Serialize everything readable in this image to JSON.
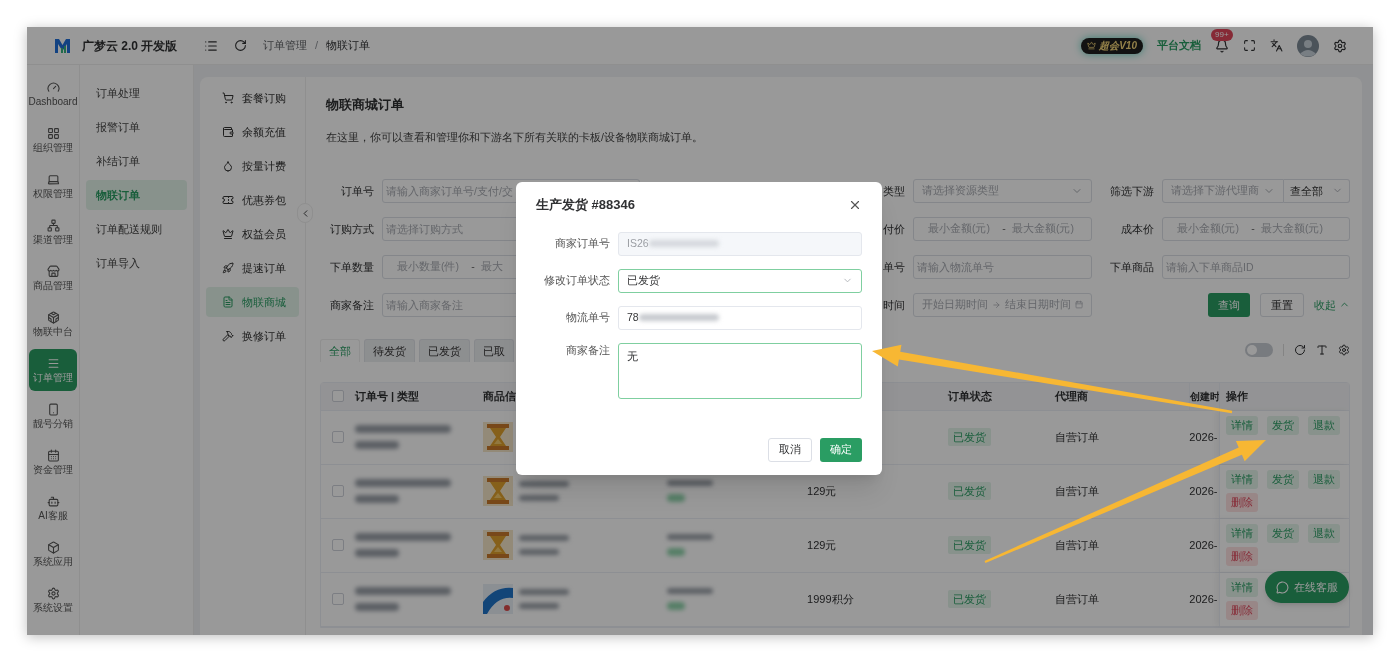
{
  "header": {
    "app_name": "广梦云 2.0 开发版",
    "breadcrumb": [
      "订单管理",
      "物联订单"
    ],
    "breadcrumb_separator": "/",
    "vip_badge": "超会V10",
    "docs_link": "平台文档",
    "notification_count": "99+"
  },
  "rail": [
    {
      "label": "Dashboard",
      "selected": false
    },
    {
      "label": "组织管理",
      "selected": false
    },
    {
      "label": "权限管理",
      "selected": false
    },
    {
      "label": "渠道管理",
      "selected": false
    },
    {
      "label": "商品管理",
      "selected": false
    },
    {
      "label": "物联中台",
      "selected": false
    },
    {
      "label": "订单管理",
      "selected": true
    },
    {
      "label": "靓号分销",
      "selected": false
    },
    {
      "label": "资金管理",
      "selected": false
    },
    {
      "label": "AI客服",
      "selected": false
    },
    {
      "label": "系统应用",
      "selected": false
    },
    {
      "label": "系统设置",
      "selected": false
    }
  ],
  "submenu": [
    {
      "label": "订单处理",
      "selected": false
    },
    {
      "label": "报警订单",
      "selected": false
    },
    {
      "label": "补结订单",
      "selected": false
    },
    {
      "label": "物联订单",
      "selected": true
    },
    {
      "label": "订单配送规则",
      "selected": false
    },
    {
      "label": "订单导入",
      "selected": false
    }
  ],
  "inner_menu": [
    {
      "label": "套餐订购",
      "selected": false
    },
    {
      "label": "余额充值",
      "selected": false
    },
    {
      "label": "按量计费",
      "selected": false
    },
    {
      "label": "优惠券包",
      "selected": false
    },
    {
      "label": "权益会员",
      "selected": false
    },
    {
      "label": "提速订单",
      "selected": false
    },
    {
      "label": "物联商城",
      "selected": true
    },
    {
      "label": "换修订单",
      "selected": false
    }
  ],
  "page": {
    "title": "物联商城订单",
    "description": "在这里，你可以查看和管理你和下游名下所有关联的卡板/设备物联商城订单。"
  },
  "filters": [
    [
      {
        "label": "订单号",
        "kind": "input",
        "placeholder": "请输入商家订单号/支付/交"
      },
      {
        "label": "类型",
        "kind": "select",
        "placeholder": "请选择资源类型"
      },
      {
        "label": "筛选下游",
        "kind": "select_pair",
        "placeholder": "请选择下游代理商",
        "value": "查全部"
      }
    ],
    [
      {
        "label": "订购方式",
        "kind": "input",
        "placeholder": "请选择订购方式"
      },
      {
        "label": "付价",
        "kind": "range",
        "placeholder": "最小金额(元)",
        "placeholder_end": "最大金额(元)",
        "separator": "-"
      },
      {
        "label": "成本价",
        "kind": "range",
        "placeholder": "最小金额(元)",
        "placeholder_end": "最大金额(元)",
        "separator": "-"
      }
    ],
    [
      {
        "label": "下单数量",
        "kind": "range",
        "placeholder": "最小数量(件)",
        "placeholder_end": "最大",
        "separator": "-"
      },
      {
        "label": "单号",
        "kind": "input",
        "placeholder": "请输入物流单号"
      },
      {
        "label": "下单商品",
        "kind": "input",
        "placeholder": "请输入下单商品ID"
      }
    ],
    [
      {
        "label": "商家备注",
        "kind": "input",
        "placeholder": "请输入商家备注"
      },
      {
        "label": "时间",
        "kind": "daterange",
        "placeholder": "开始日期时间",
        "placeholder_end": "结束日期时间"
      }
    ]
  ],
  "filter_actions": [
    {
      "label": "查询",
      "kind": "primary"
    },
    {
      "label": "重置",
      "kind": "default"
    },
    {
      "label": "收起",
      "kind": "link"
    }
  ],
  "tabs": [
    {
      "label": "全部",
      "selected": true
    },
    {
      "label": "待发货",
      "selected": false
    },
    {
      "label": "已发货",
      "selected": false
    },
    {
      "label": "已取",
      "selected": false
    }
  ],
  "table_switch": {
    "on": false
  },
  "table": {
    "all_checked": false,
    "columns": [
      "订单号 | 类型",
      "商品信",
      "订单状态",
      "代理商",
      "创建时",
      "操作"
    ],
    "rows": [
      {
        "checked": false,
        "status": "已发货",
        "agent": "自营订单",
        "created": "2026-",
        "actions": [
          {
            "label": "详情",
            "kind": "default"
          },
          {
            "label": "发货",
            "kind": "default"
          },
          {
            "label": "退款",
            "kind": "default"
          }
        ]
      },
      {
        "checked": false,
        "price": "129元",
        "status": "已发货",
        "agent": "自营订单",
        "created": "2026-",
        "actions": [
          {
            "label": "详情",
            "kind": "default"
          },
          {
            "label": "发货",
            "kind": "default"
          },
          {
            "label": "退款",
            "kind": "default"
          },
          {
            "label": "删除",
            "kind": "danger"
          }
        ]
      },
      {
        "checked": false,
        "price": "129元",
        "status": "已发货",
        "agent": "自营订单",
        "created": "2026-",
        "actions": [
          {
            "label": "详情",
            "kind": "default"
          },
          {
            "label": "发货",
            "kind": "default"
          },
          {
            "label": "退款",
            "kind": "default"
          },
          {
            "label": "删除",
            "kind": "danger"
          }
        ]
      },
      {
        "checked": false,
        "price": "1999积分",
        "status": "已发货",
        "agent": "自营订单",
        "created": "2026-",
        "actions": [
          {
            "label": "详情",
            "kind": "default"
          },
          {
            "label": "删除",
            "kind": "danger"
          }
        ]
      }
    ]
  },
  "chat_button": "在线客服",
  "modal": {
    "title": "生产发货 #88346",
    "fields": [
      {
        "label": "商家订单号",
        "kind": "disabled",
        "value": "IS26"
      },
      {
        "label": "修改订单状态",
        "kind": "select",
        "value": "已发货"
      },
      {
        "label": "物流单号",
        "kind": "input",
        "value": "78"
      },
      {
        "label": "商家备注",
        "kind": "textarea",
        "value": "无"
      }
    ],
    "buttons": [
      {
        "label": "取消",
        "kind": "default"
      },
      {
        "label": "确定",
        "kind": "primary"
      }
    ]
  }
}
